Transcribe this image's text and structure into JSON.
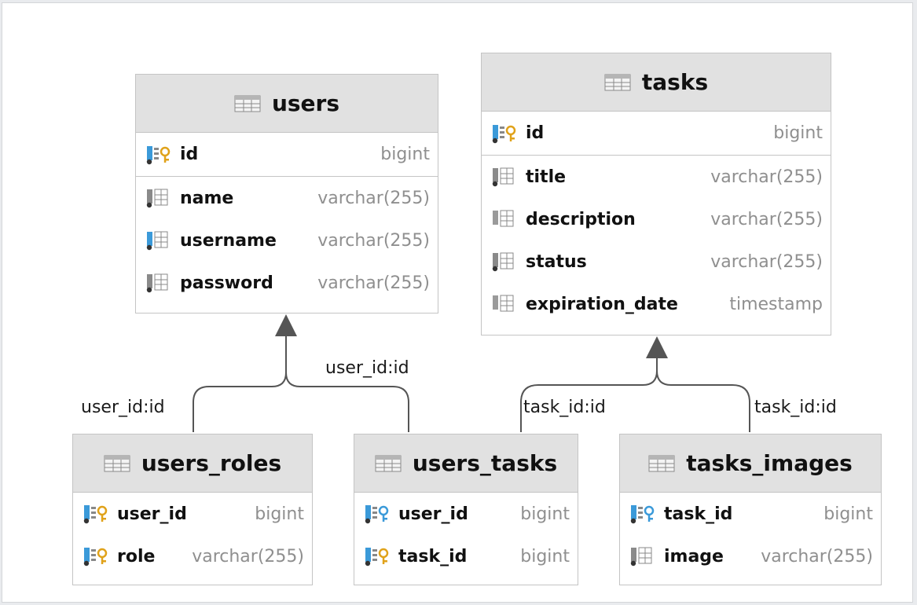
{
  "tables": {
    "users": {
      "name": "users",
      "columns": [
        {
          "name": "id",
          "type": "bigint",
          "icon": "primary-key-icon"
        },
        {
          "name": "name",
          "type": "varchar(255)",
          "icon": "column-icon"
        },
        {
          "name": "username",
          "type": "varchar(255)",
          "icon": "column-icon"
        },
        {
          "name": "password",
          "type": "varchar(255)",
          "icon": "column-icon"
        }
      ]
    },
    "tasks": {
      "name": "tasks",
      "columns": [
        {
          "name": "id",
          "type": "bigint",
          "icon": "primary-key-icon"
        },
        {
          "name": "title",
          "type": "varchar(255)",
          "icon": "column-icon"
        },
        {
          "name": "description",
          "type": "varchar(255)",
          "icon": "column-icon"
        },
        {
          "name": "status",
          "type": "varchar(255)",
          "icon": "column-icon"
        },
        {
          "name": "expiration_date",
          "type": "timestamp",
          "icon": "column-icon"
        }
      ]
    },
    "users_roles": {
      "name": "users_roles",
      "columns": [
        {
          "name": "user_id",
          "type": "bigint",
          "icon": "foreign-key-icon"
        },
        {
          "name": "role",
          "type": "varchar(255)",
          "icon": "foreign-key-icon"
        }
      ]
    },
    "users_tasks": {
      "name": "users_tasks",
      "columns": [
        {
          "name": "user_id",
          "type": "bigint",
          "icon": "foreign-key-icon"
        },
        {
          "name": "task_id",
          "type": "bigint",
          "icon": "foreign-key-icon"
        }
      ]
    },
    "tasks_images": {
      "name": "tasks_images",
      "columns": [
        {
          "name": "task_id",
          "type": "bigint",
          "icon": "foreign-key-icon"
        },
        {
          "name": "image",
          "type": "varchar(255)",
          "icon": "column-icon"
        }
      ]
    }
  },
  "relations": [
    {
      "label": "user_id:id",
      "from": "users_roles",
      "to": "users"
    },
    {
      "label": "user_id:id",
      "from": "users_tasks",
      "to": "users"
    },
    {
      "label": "task_id:id",
      "from": "users_tasks",
      "to": "tasks"
    },
    {
      "label": "task_id:id",
      "from": "tasks_images",
      "to": "tasks"
    }
  ],
  "colors": {
    "header_bg": "#e1e1e1",
    "border": "#c4c4c4",
    "type_text": "#8f8f8f",
    "edge": "#555555",
    "key_gold": "#e0a21a",
    "key_blue": "#3b9ad9"
  }
}
